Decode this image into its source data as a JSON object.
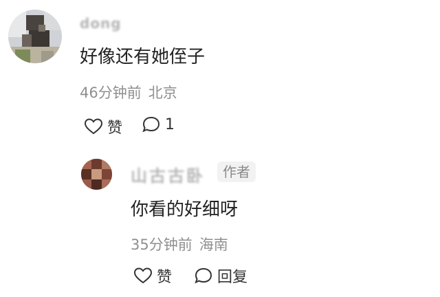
{
  "colors": {
    "background": "#ffffff",
    "text_primary": "#222222",
    "text_meta": "#8f8f8f",
    "tag_bg": "#f2f2f2"
  },
  "comments": [
    {
      "username": "dong",
      "text": "好像还有她侄子",
      "time": "46分钟前",
      "location": "北京",
      "like_label": "赞",
      "comment_count": "1",
      "avatar_icon": "user-avatar-icon"
    }
  ],
  "replies": [
    {
      "username": "山古古卧",
      "tag": "作者",
      "text": "你看的好细呀",
      "time": "35分钟前",
      "location": "海南",
      "like_label": "赞",
      "reply_label": "回复",
      "avatar_icon": "user-avatar-icon"
    }
  ]
}
